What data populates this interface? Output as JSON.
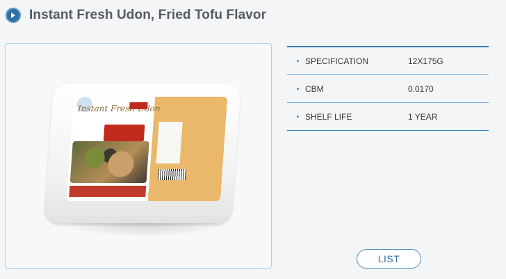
{
  "page": {
    "title": "Instant Fresh Udon, Fried Tofu Flavor",
    "title_icon": "play-circle-icon"
  },
  "product_image": {
    "alt": "Instant Fresh Udon",
    "brand_text": "Instant Fresh Udon"
  },
  "specs": [
    {
      "label": "SPECIFICATION",
      "value": "12X175G"
    },
    {
      "label": "CBM",
      "value": "0.0170"
    },
    {
      "label": "SHELF LIFE",
      "value": "1 YEAR"
    }
  ],
  "actions": {
    "list_label": "LIST"
  },
  "colors": {
    "accent": "#2f7cb8",
    "title_icon_bg": "#2f6fa3",
    "frame_border": "#a8d3ec"
  }
}
